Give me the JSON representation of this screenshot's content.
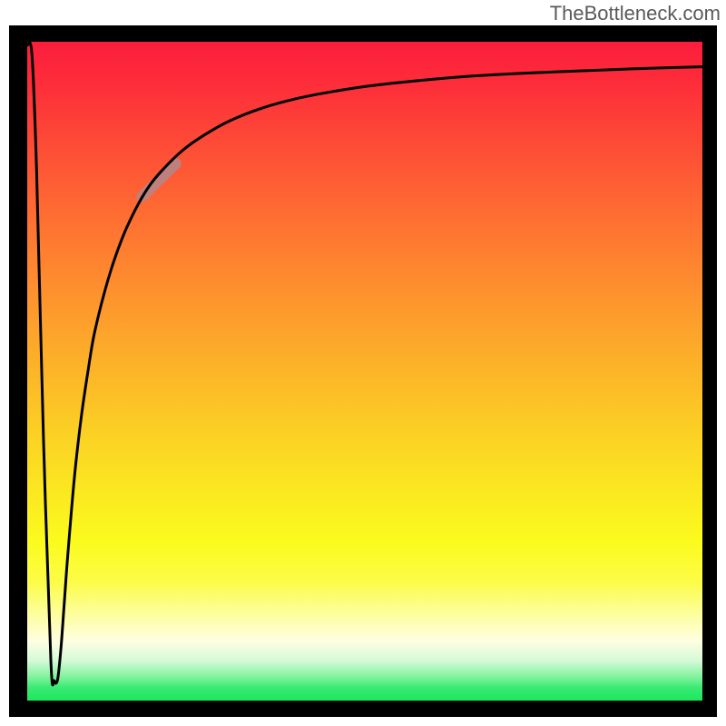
{
  "attribution": "TheBottleneck.com",
  "colors": {
    "frame": "#000000",
    "text": "#5a5a5a",
    "curve": "#000000",
    "highlight": "#bb8383"
  },
  "chart_data": {
    "type": "line",
    "title": "",
    "xlabel": "",
    "ylabel": "",
    "xlim": [
      0,
      100
    ],
    "ylim": [
      0,
      100
    ],
    "grid": false,
    "background_gradient": {
      "orientation": "vertical",
      "stops": [
        {
          "pos": 0.0,
          "color": "#fc1d3c"
        },
        {
          "pos": 0.36,
          "color": "#fe8b2f"
        },
        {
          "pos": 0.7,
          "color": "#fbec20"
        },
        {
          "pos": 0.91,
          "color": "#fefee2"
        },
        {
          "pos": 1.0,
          "color": "#1ce75d"
        }
      ]
    },
    "series": [
      {
        "name": "bottleneck-curve",
        "note": "y estimated from pixel position; 0=bottom, 100=top",
        "x": [
          0.0,
          0.7,
          1.4,
          2.4,
          3.5,
          4.0,
          4.5,
          5.0,
          5.5,
          6.0,
          7.0,
          8.0,
          9.0,
          10.0,
          12.0,
          14.0,
          16.0,
          18.0,
          20.0,
          23.0,
          26.0,
          30.0,
          35.0,
          40.0,
          45.0,
          50.0,
          55.0,
          60.0,
          66.0,
          73.0,
          80.0,
          90.0,
          100.0
        ],
        "y": [
          99.5,
          98.0,
          80.0,
          40.0,
          6.0,
          3.0,
          3.2,
          8.0,
          15.0,
          22.0,
          34.0,
          43.0,
          50.0,
          56.0,
          64.0,
          70.0,
          74.5,
          78.0,
          80.5,
          83.5,
          85.7,
          88.0,
          90.0,
          91.4,
          92.4,
          93.2,
          93.8,
          94.3,
          94.8,
          95.2,
          95.5,
          95.9,
          96.2
        ]
      }
    ],
    "highlight_segment": {
      "x_range": [
        17.0,
        22.0
      ],
      "approx_y": [
        76.5,
        81.5
      ],
      "stroke_width_px": 12,
      "color": "#bb8383"
    }
  }
}
